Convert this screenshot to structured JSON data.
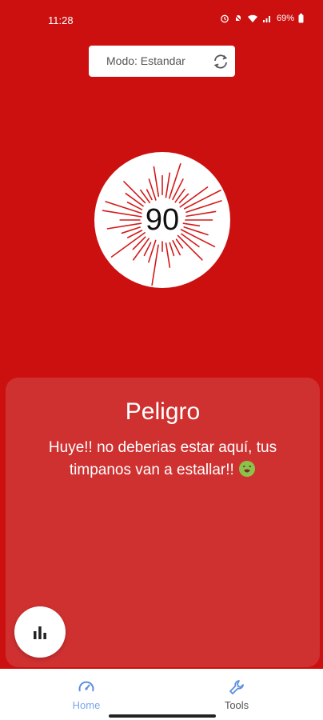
{
  "status_bar": {
    "time": "11:28",
    "battery": "69%"
  },
  "mode_selector": {
    "label": "Modo: Estandar",
    "icon": "refresh-icon"
  },
  "meter": {
    "value": "90"
  },
  "card": {
    "title": "Peligro",
    "message": "Huye!! no deberias estar aquí, tus timpanos van a estallar!!",
    "emoji_icon": "nauseated-face-icon"
  },
  "stats_button": {
    "icon": "bar-chart-icon"
  },
  "bottom_nav": {
    "items": [
      {
        "label": "Home",
        "icon": "speedometer-icon",
        "active": true
      },
      {
        "label": "Tools",
        "icon": "wrench-icon",
        "active": false
      }
    ]
  },
  "colors": {
    "background": "#cc1010",
    "card": "#cf3131",
    "active_nav": "#7aa7e8"
  }
}
